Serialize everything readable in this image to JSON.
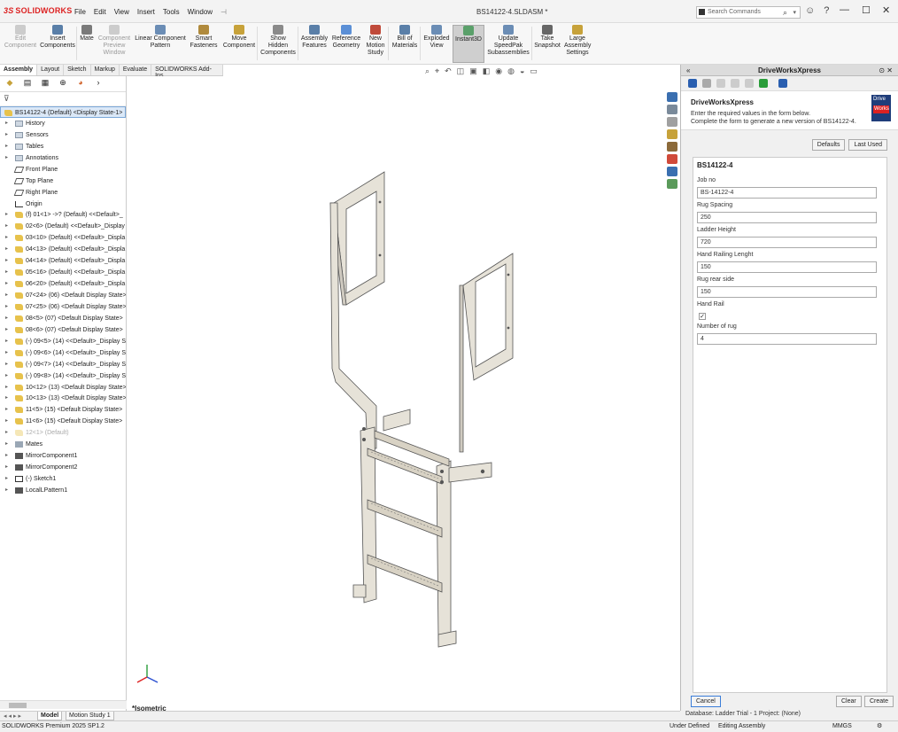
{
  "app": {
    "brand": "SOLIDWORKS",
    "document_title": "BS14122-4.SLDASM *",
    "menu": [
      "File",
      "Edit",
      "View",
      "Insert",
      "Tools",
      "Window"
    ],
    "search_placeholder": "Search Commands"
  },
  "ribbon": [
    {
      "label": "Edit\nComponent",
      "disabled": true,
      "icon_color": "#cccccc"
    },
    {
      "label": "Insert\nComponents",
      "disabled": false,
      "icon_color": "#5a7fa8"
    },
    {
      "label": "Mate",
      "disabled": false,
      "icon_color": "#7a7a7a"
    },
    {
      "label": "Component\nPreview\nWindow",
      "disabled": true,
      "icon_color": "#cccccc"
    },
    {
      "label": "Linear Component\nPattern",
      "disabled": false,
      "icon_color": "#6b8db5"
    },
    {
      "label": "Smart\nFasteners",
      "disabled": false,
      "icon_color": "#b08a3c"
    },
    {
      "label": "Move\nComponent",
      "disabled": false,
      "icon_color": "#c7a23a"
    },
    {
      "label": "Show\nHidden\nComponents",
      "disabled": false,
      "icon_color": "#8a8a8a"
    },
    {
      "label": "Assembly\nFeatures",
      "disabled": false,
      "icon_color": "#5a7fa8"
    },
    {
      "label": "Reference\nGeometry",
      "disabled": false,
      "icon_color": "#5b8fd6"
    },
    {
      "label": "New\nMotion\nStudy",
      "disabled": false,
      "icon_color": "#c04a3a"
    },
    {
      "label": "Bill of\nMaterials",
      "disabled": false,
      "icon_color": "#5a7fa8"
    },
    {
      "label": "Exploded\nView",
      "disabled": false,
      "icon_color": "#6b8db5"
    },
    {
      "label": "Instant3D",
      "disabled": false,
      "icon_color": "#5aa06a",
      "active": true
    },
    {
      "label": "Update\nSpeedPak\nSubassemblies",
      "disabled": false,
      "icon_color": "#6b8db5"
    },
    {
      "label": "Take\nSnapshot",
      "disabled": false,
      "icon_color": "#666666"
    },
    {
      "label": "Large\nAssembly\nSettings",
      "disabled": false,
      "icon_color": "#c7a23a"
    }
  ],
  "command_tabs": [
    "Assembly",
    "Layout",
    "Sketch",
    "Markup",
    "Evaluate",
    "SOLIDWORKS Add-Ins"
  ],
  "tree": [
    {
      "label": "BS14122-4 (Default) <Display State-1>",
      "icon": "part",
      "root": true
    },
    {
      "label": "History",
      "icon": "folder"
    },
    {
      "label": "Sensors",
      "icon": "folder"
    },
    {
      "label": "Tables",
      "icon": "folder"
    },
    {
      "label": "Annotations",
      "icon": "folder"
    },
    {
      "label": "Front Plane",
      "icon": "plane"
    },
    {
      "label": "Top Plane",
      "icon": "plane"
    },
    {
      "label": "Right Plane",
      "icon": "plane"
    },
    {
      "label": "Origin",
      "icon": "origin"
    },
    {
      "label": "(f) 01<1> ->? (Default) <<Default>_",
      "icon": "part"
    },
    {
      "label": "02<6> (Default) <<Default>_Display",
      "icon": "part"
    },
    {
      "label": "03<10> (Default) <<Default>_Displa",
      "icon": "part"
    },
    {
      "label": "04<13> (Default) <<Default>_Displa",
      "icon": "part"
    },
    {
      "label": "04<14> (Default) <<Default>_Displa",
      "icon": "part"
    },
    {
      "label": "05<16> (Default) <<Default>_Displa",
      "icon": "part"
    },
    {
      "label": "06<20> (Default) <<Default>_Displa",
      "icon": "part"
    },
    {
      "label": "07<24> (06) <Default Display State>",
      "icon": "part"
    },
    {
      "label": "07<25> (06) <Default Display State>",
      "icon": "part"
    },
    {
      "label": "08<5> (07) <Default Display State>",
      "icon": "part"
    },
    {
      "label": "08<6> (07) <Default Display State>",
      "icon": "part"
    },
    {
      "label": "(-) 09<5> (14) <<Default>_Display S",
      "icon": "part"
    },
    {
      "label": "(-) 09<6> (14) <<Default>_Display S",
      "icon": "part"
    },
    {
      "label": "(-) 09<7> (14) <<Default>_Display S",
      "icon": "part"
    },
    {
      "label": "(-) 09<8> (14) <<Default>_Display S",
      "icon": "part"
    },
    {
      "label": "10<12> (13) <Default Display State>",
      "icon": "part"
    },
    {
      "label": "10<13> (13) <Default Display State>",
      "icon": "part"
    },
    {
      "label": "11<5> (15) <Default Display State>",
      "icon": "part"
    },
    {
      "label": "11<6> (15) <Default Display State>",
      "icon": "part"
    },
    {
      "label": "12<1> (Default)",
      "icon": "part",
      "grey": true
    },
    {
      "label": "Mates",
      "icon": "mates"
    },
    {
      "label": "MirrorComponent1",
      "icon": "mirror"
    },
    {
      "label": "MirrorComponent2",
      "icon": "mirror"
    },
    {
      "label": "(-) Sketch1",
      "icon": "sketch"
    },
    {
      "label": "LocalLPattern1",
      "icon": "mirror"
    }
  ],
  "graphics": {
    "view_label": "*Isometric"
  },
  "panel": {
    "title": "DriveWorksXpress",
    "heading": "DriveWorksXpress",
    "desc1": "Enter the required values in the form below.",
    "desc2": "Complete the form to generate a new version of BS14122-4.",
    "logo_top": "Drive",
    "logo_bottom": "Works",
    "defaults_label": "Defaults",
    "last_used_label": "Last Used",
    "form_title": "BS14122-4",
    "fields": [
      {
        "label": "Job no",
        "value": "BS-14122-4"
      },
      {
        "label": "Rug Spacing",
        "value": "250"
      },
      {
        "label": "Ladder Height",
        "value": "720"
      },
      {
        "label": "Hand Railing Lenght",
        "value": "150"
      },
      {
        "label": "Rug rear side",
        "value": "150"
      }
    ],
    "checkbox_label": "Hand Rail",
    "checkbox_checked": true,
    "last_field": {
      "label": "Number of rug",
      "value": "4"
    },
    "cancel_label": "Cancel",
    "clear_label": "Clear",
    "create_label": "Create",
    "database_line": "Database: Ladder Trial - 1   Project: (None)"
  },
  "model_tabs": [
    "Model",
    "Motion Study 1"
  ],
  "status": {
    "product": "SOLIDWORKS Premium 2025 SP1.2",
    "state": "Under Defined",
    "mode": "Editing Assembly",
    "units": "MMGS"
  }
}
